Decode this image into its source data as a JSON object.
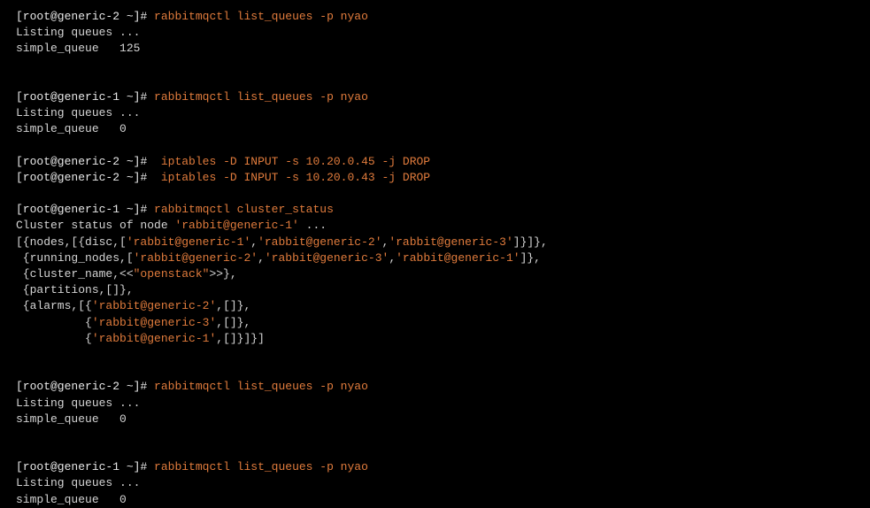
{
  "blocks": [
    {
      "prompt": "[root@generic-2 ~]",
      "hash": "#",
      "command": " rabbitmqctl list_queues -p nyao",
      "output": [
        "Listing queues ...",
        "simple_queue   125"
      ]
    },
    {
      "prompt": "[root@generic-1 ~]",
      "hash": "#",
      "command": " rabbitmqctl list_queues -p nyao",
      "output": [
        "Listing queues ...",
        "simple_queue   0"
      ]
    },
    {
      "prompt": "[root@generic-2 ~]",
      "hash": "#",
      "command": "  iptables -D INPUT -s 10.20.0.45 -j DROP",
      "output": []
    },
    {
      "prompt": "[root@generic-2 ~]",
      "hash": "#",
      "command": "  iptables -D INPUT -s 10.20.0.43 -j DROP",
      "output": []
    },
    {
      "prompt": "[root@generic-1 ~]",
      "hash": "#",
      "command": " rabbitmqctl cluster_status",
      "status_lines": [
        {
          "pre": "Cluster status of node ",
          "s": "'rabbit@generic-1'",
          "post": " ..."
        },
        {
          "pre": "[{nodes,[{disc,[",
          "parts": [
            "'rabbit@generic-1'",
            ",",
            "'rabbit@generic-2'",
            ",",
            "'rabbit@generic-3'"
          ],
          "post": "]}]},"
        },
        {
          "pre": " {running_nodes,[",
          "parts": [
            "'rabbit@generic-2'",
            ",",
            "'rabbit@generic-3'",
            ",",
            "'rabbit@generic-1'"
          ],
          "post": "]},"
        },
        {
          "pre": " {cluster_name,<<",
          "s": "\"openstack\"",
          "post": ">>},"
        },
        {
          "plain": " {partitions,[]},"
        },
        {
          "pre": " {alarms,[{",
          "s": "'rabbit@generic-2'",
          "post": ",[]},"
        },
        {
          "pre": "          {",
          "s": "'rabbit@generic-3'",
          "post": ",[]},"
        },
        {
          "pre": "          {",
          "s": "'rabbit@generic-1'",
          "post": ",[]}]}]"
        }
      ]
    },
    {
      "prompt": "[root@generic-2 ~]",
      "hash": "#",
      "command": " rabbitmqctl list_queues -p nyao",
      "output": [
        "Listing queues ...",
        "simple_queue   0"
      ]
    },
    {
      "prompt": "[root@generic-1 ~]",
      "hash": "#",
      "command": " rabbitmqctl list_queues -p nyao",
      "output": [
        "Listing queues ...",
        "simple_queue   0"
      ]
    }
  ]
}
